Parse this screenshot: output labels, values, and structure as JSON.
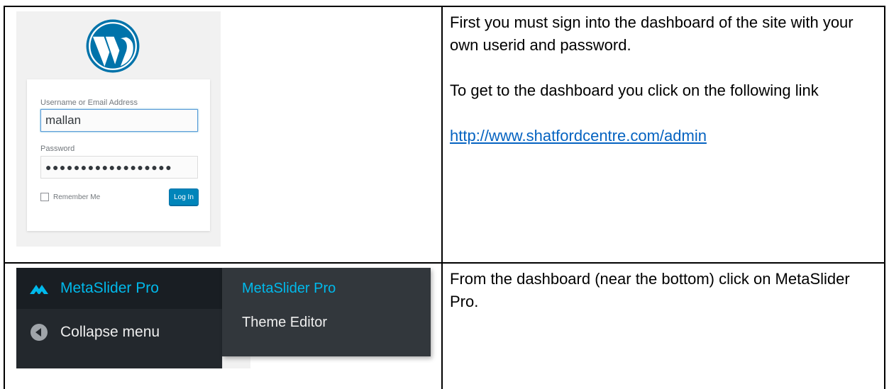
{
  "step1": {
    "login": {
      "username_label": "Username or Email Address",
      "username_value": "mallan",
      "password_label": "Password",
      "password_masked": "●●●●●●●●●●●●●●●●●●",
      "remember_label": "Remember Me",
      "login_button": "Log In"
    },
    "instructions": {
      "line1": "First you must sign into the dashboard of the site with your own userid and password.",
      "line2": "To get to the dashboard you click on the following link",
      "link": "http://www.shatfordcentre.com/admin"
    }
  },
  "step2": {
    "menu": {
      "metaslider_item": "MetaSlider Pro",
      "collapse_item": "Collapse menu",
      "submenu": [
        "MetaSlider Pro",
        "Theme Editor"
      ]
    },
    "instructions": {
      "line1": "From the dashboard (near the bottom) click on MetaSlider Pro."
    }
  },
  "colors": {
    "wp_blue": "#0073aa",
    "link": "#0563c1",
    "admin_bg": "#23282d",
    "admin_highlight": "#00b9eb"
  }
}
